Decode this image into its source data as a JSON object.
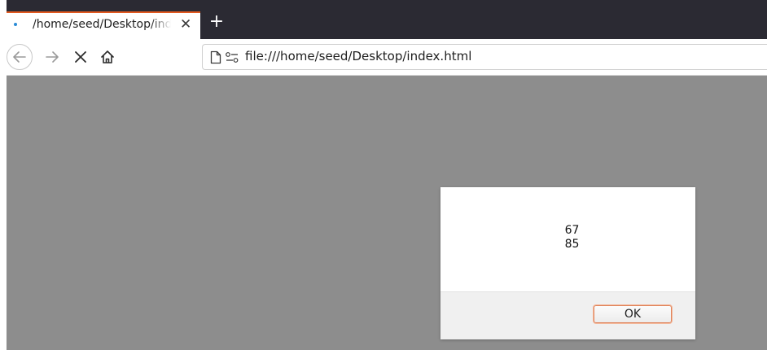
{
  "tab": {
    "title": "/home/seed/Desktop/index.html",
    "close_glyph": "✕",
    "indicator_color": "#2a8bd6",
    "accent_color": "#e25920"
  },
  "new_tab": {
    "label": "+"
  },
  "nav": {
    "back_icon": "back-arrow-icon",
    "forward_icon": "forward-arrow-icon",
    "stop_icon": "close-icon",
    "home_icon": "home-icon"
  },
  "urlbar": {
    "url": "file:///home/seed/Desktop/index.html",
    "page_icon": "page-icon",
    "permissions_icon": "permissions-icon"
  },
  "content": {
    "background": "#8d8d8d"
  },
  "alert": {
    "lines": [
      "67",
      "85"
    ],
    "ok_label": "OK"
  }
}
